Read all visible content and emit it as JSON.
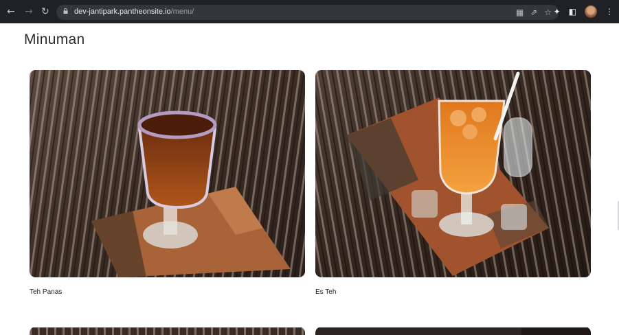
{
  "browser": {
    "url_domain": "dev-jantipark.pantheonsite.io",
    "url_path": "/menu/",
    "back_icon": "arrow-left-icon",
    "forward_icon": "arrow-right-icon",
    "reload_icon": "reload-icon",
    "menu_icon": "kebab-menu-icon"
  },
  "page": {
    "title": "Minuman"
  },
  "items": [
    {
      "name": "Teh Panas"
    },
    {
      "name": "Es Teh"
    }
  ]
}
